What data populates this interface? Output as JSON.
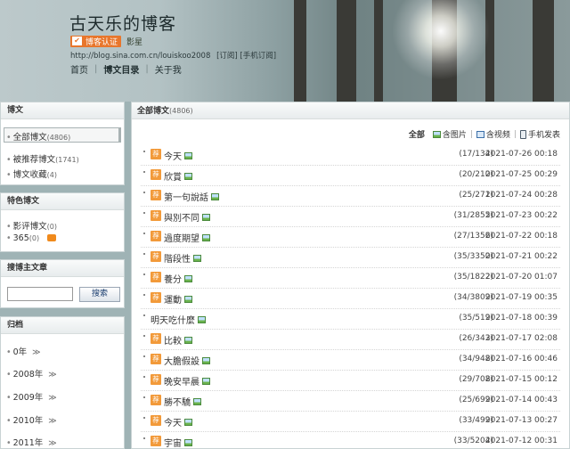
{
  "header": {
    "blog_title": "古天乐的博客",
    "cert_badge": "博客认证",
    "cert_text": "影星",
    "url": "http://blog.sina.com.cn/louiskoo2008",
    "url_links": "[订阅] [手机订阅]",
    "nav": [
      "首页",
      "博文目录",
      "关于我"
    ],
    "nav_active": 1
  },
  "sidebar": {
    "posts_panel": {
      "title": "博文",
      "items": [
        {
          "label": "全部博文",
          "count": "(4806)",
          "selected": true
        },
        {
          "label": "被推荐博文",
          "count": "(1741)"
        },
        {
          "label": "博文收藏",
          "count": "(4)"
        }
      ]
    },
    "special_panel": {
      "title": "特色博文",
      "items": [
        {
          "label": "影评博文",
          "count": "(0)"
        },
        {
          "label": "365",
          "count": "(0)"
        }
      ]
    },
    "search_panel": {
      "title": "搜博主文章",
      "input_value": "",
      "button_label": "搜索"
    },
    "archive_panel": {
      "title": "归档",
      "items": [
        "0年",
        "2008年",
        "2009年",
        "2010年",
        "2011年"
      ]
    }
  },
  "main": {
    "title": "全部博文",
    "count": "(4806)",
    "filters": {
      "all": "全部",
      "with_images": "含图片",
      "with_video": "含视频",
      "mobile": "手机发表"
    },
    "posts": [
      {
        "title": "今天",
        "rec": true,
        "pic": true,
        "count": "(17/134)",
        "date": "2021-07-26 00:18"
      },
      {
        "title": "欣賞",
        "rec": true,
        "pic": true,
        "count": "(20/210)",
        "date": "2021-07-25 00:29"
      },
      {
        "title": "第一句說話",
        "rec": true,
        "pic": true,
        "count": "(25/271)",
        "date": "2021-07-24 00:28"
      },
      {
        "title": "與別不同",
        "rec": true,
        "pic": true,
        "count": "(31/2855)",
        "date": "2021-07-23 00:22"
      },
      {
        "title": "過度期望",
        "rec": true,
        "pic": true,
        "count": "(27/1356)",
        "date": "2021-07-22 00:18"
      },
      {
        "title": "階段性",
        "rec": true,
        "pic": true,
        "count": "(35/3350)",
        "date": "2021-07-21 00:22"
      },
      {
        "title": "養分",
        "rec": true,
        "pic": true,
        "count": "(35/1822)",
        "date": "2021-07-20 01:07"
      },
      {
        "title": "運動",
        "rec": true,
        "pic": true,
        "count": "(34/3809)",
        "date": "2021-07-19 00:35"
      },
      {
        "title": "明天吃什麼",
        "rec": false,
        "pic": true,
        "count": "(35/519)",
        "date": "2021-07-18 00:39"
      },
      {
        "title": "比較",
        "rec": true,
        "pic": true,
        "count": "(26/343)",
        "date": "2021-07-17 02:08"
      },
      {
        "title": "大膽假設",
        "rec": true,
        "pic": true,
        "count": "(34/948)",
        "date": "2021-07-16 00:46"
      },
      {
        "title": "晚安早晨",
        "rec": true,
        "pic": true,
        "count": "(29/708)",
        "date": "2021-07-15 00:12"
      },
      {
        "title": "勝不驕",
        "rec": true,
        "pic": true,
        "count": "(25/699)",
        "date": "2021-07-14 00:43"
      },
      {
        "title": "今天",
        "rec": true,
        "pic": true,
        "count": "(33/499)",
        "date": "2021-07-13 00:27"
      },
      {
        "title": "宇宙",
        "rec": true,
        "pic": true,
        "count": "(33/5204)",
        "date": "2021-07-12 00:31"
      }
    ],
    "rec_tag": "荐"
  }
}
